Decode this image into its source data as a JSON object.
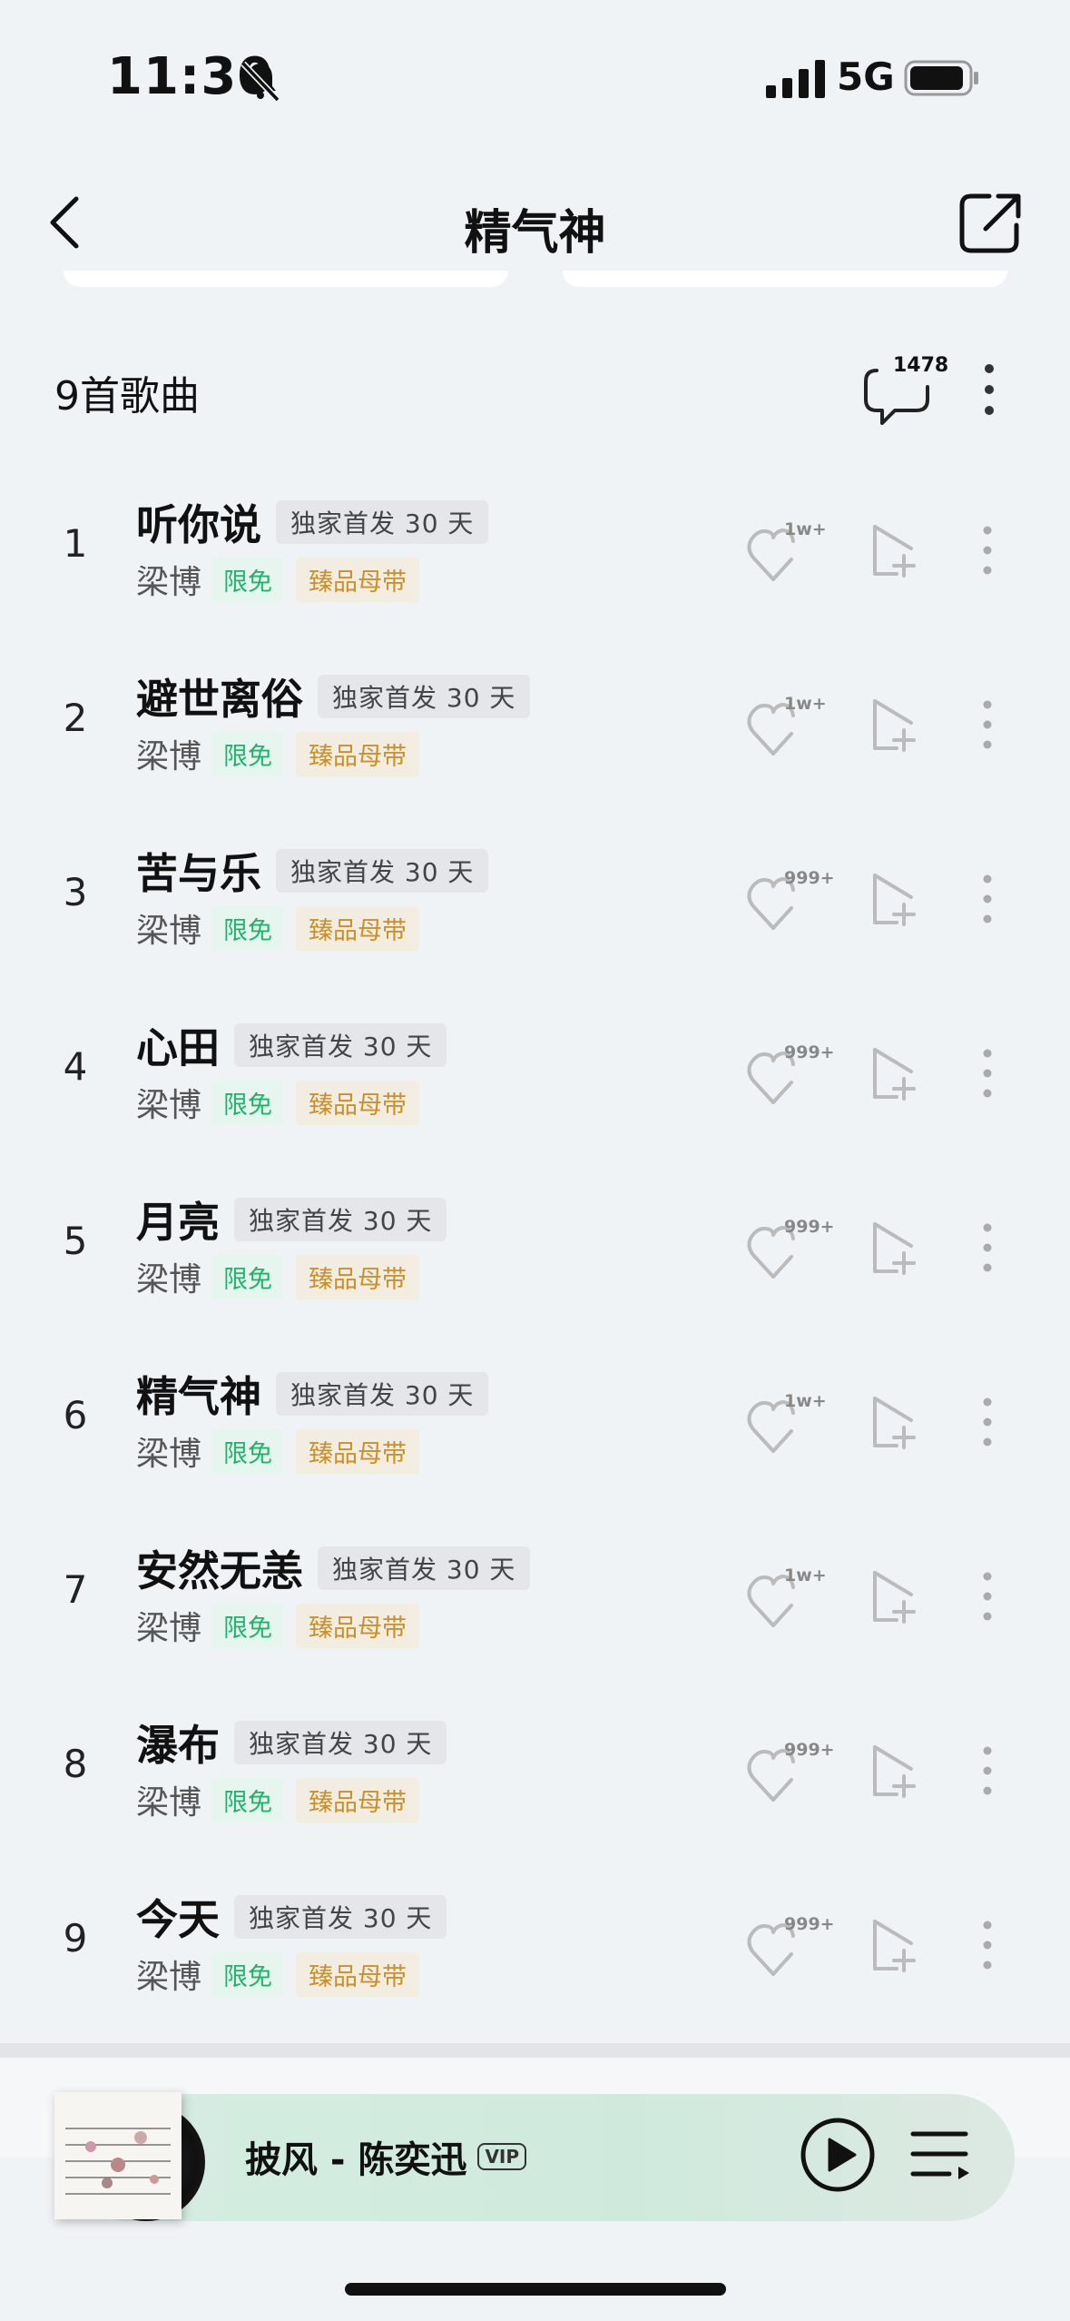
{
  "status_bar": {
    "time": "11:30",
    "network": "5G"
  },
  "nav": {
    "title": "精气神"
  },
  "list_header": {
    "song_count": "9首歌曲",
    "comment_count": "1478"
  },
  "songs": [
    {
      "index": "1",
      "title": "听你说",
      "tag": "独家首发 30 天",
      "artist": "梁博",
      "free": "限免",
      "quality": "臻品母带",
      "likes": "1w+"
    },
    {
      "index": "2",
      "title": "避世离俗",
      "tag": "独家首发 30 天",
      "artist": "梁博",
      "free": "限免",
      "quality": "臻品母带",
      "likes": "1w+"
    },
    {
      "index": "3",
      "title": "苦与乐",
      "tag": "独家首发 30 天",
      "artist": "梁博",
      "free": "限免",
      "quality": "臻品母带",
      "likes": "999+"
    },
    {
      "index": "4",
      "title": "心田",
      "tag": "独家首发 30 天",
      "artist": "梁博",
      "free": "限免",
      "quality": "臻品母带",
      "likes": "999+"
    },
    {
      "index": "5",
      "title": "月亮",
      "tag": "独家首发 30 天",
      "artist": "梁博",
      "free": "限免",
      "quality": "臻品母带",
      "likes": "999+"
    },
    {
      "index": "6",
      "title": "精气神",
      "tag": "独家首发 30 天",
      "artist": "梁博",
      "free": "限免",
      "quality": "臻品母带",
      "likes": "1w+"
    },
    {
      "index": "7",
      "title": "安然无恙",
      "tag": "独家首发 30 天",
      "artist": "梁博",
      "free": "限免",
      "quality": "臻品母带",
      "likes": "1w+"
    },
    {
      "index": "8",
      "title": "瀑布",
      "tag": "独家首发 30 天",
      "artist": "梁博",
      "free": "限免",
      "quality": "臻品母带",
      "likes": "999+"
    },
    {
      "index": "9",
      "title": "今天",
      "tag": "独家首发 30 天",
      "artist": "梁博",
      "free": "限免",
      "quality": "臻品母带",
      "likes": "999+"
    }
  ],
  "player": {
    "title": "披风 - 陈奕迅",
    "badge": "VIP"
  },
  "icons": {
    "status": [
      "bell-off-icon",
      "signal-icon",
      "battery-icon"
    ],
    "nav": [
      "back-icon",
      "share-icon"
    ],
    "row": [
      "heart-icon",
      "add-to-playlist-icon",
      "more-icon"
    ],
    "player": [
      "play-icon",
      "queue-icon"
    ]
  },
  "colors": {
    "free_tag": "#21b36a",
    "quality_tag": "#c7912d",
    "background": "#f0f3f6",
    "player": "#d5ede2"
  }
}
